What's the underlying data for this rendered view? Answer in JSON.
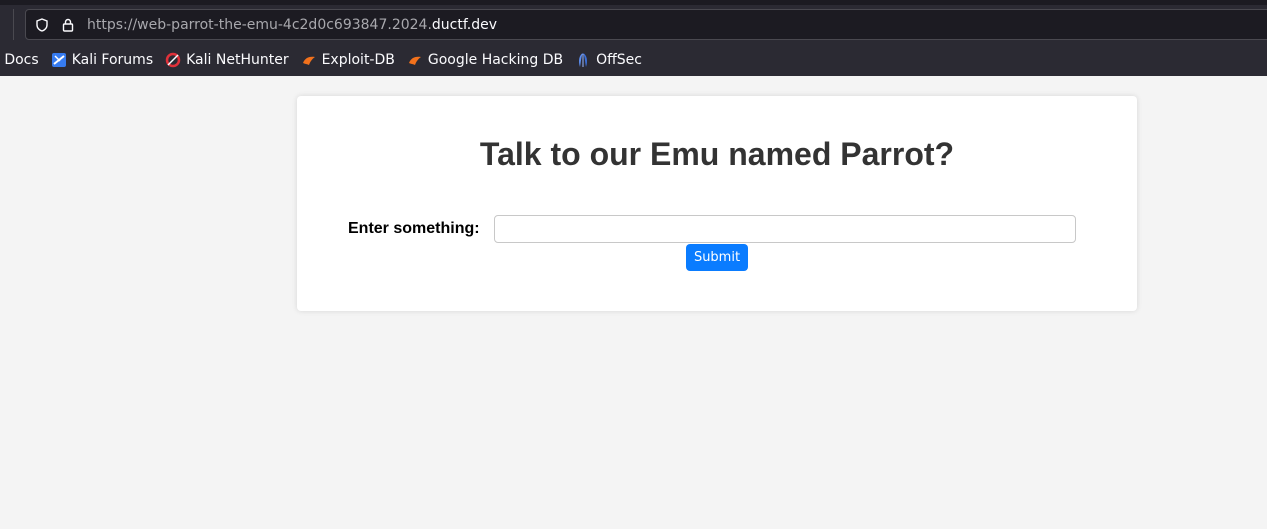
{
  "browser": {
    "url_prefix": "https://web-parrot-the-emu-4c2d0c693847.2024.",
    "url_domain": "ductf.dev",
    "bookmarks": [
      {
        "label": "i Docs"
      },
      {
        "label": "Kali Forums"
      },
      {
        "label": "Kali NetHunter"
      },
      {
        "label": "Exploit-DB"
      },
      {
        "label": "Google Hacking DB"
      },
      {
        "label": "OffSec"
      }
    ]
  },
  "page": {
    "title": "Talk to our Emu named Parrot?",
    "form": {
      "label": "Enter something:",
      "input_value": "",
      "submit_label": "Submit"
    }
  },
  "colors": {
    "chrome_bg": "#2b2a33",
    "page_bg": "#f4f4f4",
    "button_accent": "#0a7cff"
  }
}
